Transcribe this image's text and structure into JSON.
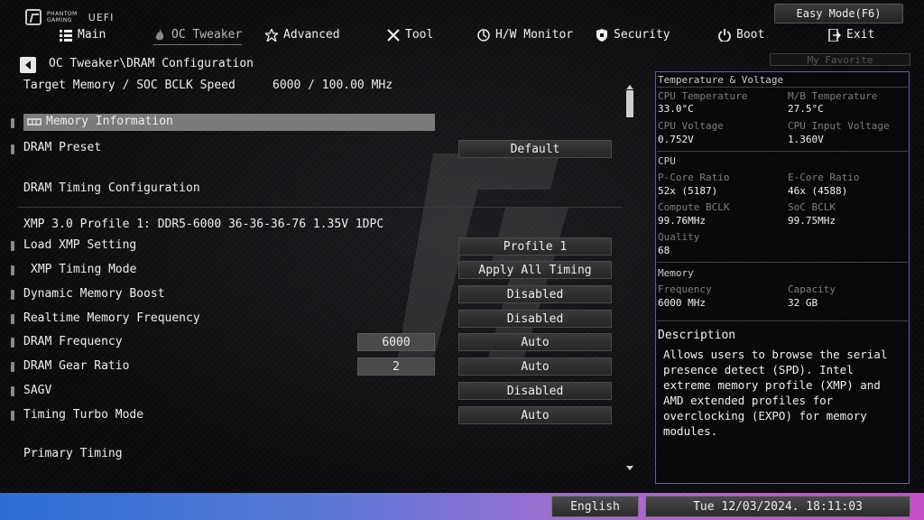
{
  "header": {
    "brand_line1": "PHANTOM",
    "brand_line2": "GAMING",
    "brand_uefi": "UEFI",
    "easy_mode_label": "Easy Mode(F6)",
    "favorite_label": "My Favorite"
  },
  "nav": {
    "items": [
      {
        "label": "Main",
        "icon": "list-icon"
      },
      {
        "label": "OC Tweaker",
        "icon": "flame-icon",
        "active": true
      },
      {
        "label": "Advanced",
        "icon": "star-icon"
      },
      {
        "label": "Tool",
        "icon": "tools-icon"
      },
      {
        "label": "H/W Monitor",
        "icon": "monitor-icon"
      },
      {
        "label": "Security",
        "icon": "shield-icon"
      },
      {
        "label": "Boot",
        "icon": "power-icon"
      },
      {
        "label": "Exit",
        "icon": "exit-icon"
      }
    ]
  },
  "breadcrumb": "OC Tweaker\\DRAM Configuration",
  "settings": {
    "target_label": "Target Memory / SOC BCLK Speed",
    "target_value": "6000 / 100.00 MHz",
    "memory_info": "Memory Information",
    "dram_preset": {
      "label": "DRAM Preset",
      "value": "Default"
    },
    "timing_config": "DRAM Timing Configuration",
    "xmp_profile": "XMP 3.0 Profile 1: DDR5-6000 36-36-36-76 1.35V 1DPC",
    "rows": [
      {
        "label": "Load XMP Setting",
        "value": "Profile 1"
      },
      {
        "label": "XMP Timing Mode",
        "value": "Apply All Timing"
      },
      {
        "label": "Dynamic Memory Boost",
        "value": "Disabled"
      },
      {
        "label": "Realtime Memory Frequency",
        "value": "Disabled"
      },
      {
        "label": "DRAM Frequency",
        "box": "6000",
        "value": "Auto"
      },
      {
        "label": "DRAM Gear Ratio",
        "box": "2",
        "value": "Auto"
      },
      {
        "label": "SAGV",
        "value": "Disabled"
      },
      {
        "label": "Timing Turbo Mode",
        "value": "Auto"
      }
    ],
    "primary_timing": "Primary Timing"
  },
  "panel": {
    "temp_title": "Temperature & Voltage",
    "cpu_temp_label": "CPU Temperature",
    "cpu_temp": "33.0°C",
    "mb_temp_label": "M/B Temperature",
    "mb_temp": "27.5°C",
    "cpu_volt_label": "CPU Voltage",
    "cpu_volt": "0.752V",
    "cpu_in_volt_label": "CPU Input Voltage",
    "cpu_in_volt": "1.360V",
    "cpu_title": "CPU",
    "pcore_label": "P-Core Ratio",
    "pcore": "52x (5187)",
    "ecore_label": "E-Core Ratio",
    "ecore": "46x (4588)",
    "cbclk_label": "Compute BCLK",
    "cbclk": "99.76MHz",
    "socbclk_label": "SoC BCLK",
    "socbclk": "99.75MHz",
    "quality_label": "Quality",
    "quality": "68",
    "mem_title": "Memory",
    "freq_label": "Frequency",
    "freq": "6000 MHz",
    "cap_label": "Capacity",
    "cap": "32 GB",
    "desc_title": "Description",
    "desc_text": "Allows users to browse the serial presence detect (SPD). Intel extreme memory profile (XMP) and AMD extended profiles for overclocking (EXPO) for memory modules."
  },
  "footer": {
    "language": "English",
    "datetime": "Tue 12/03/2024. 18:11:03"
  }
}
